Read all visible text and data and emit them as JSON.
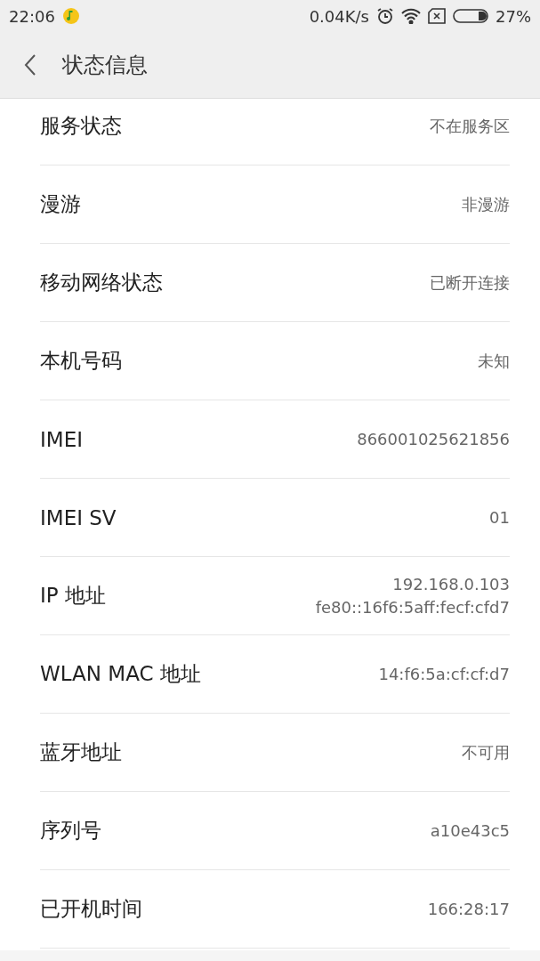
{
  "status_bar": {
    "time": "22:06",
    "speed": "0.04K/s",
    "battery": "27%"
  },
  "header": {
    "title": "状态信息"
  },
  "rows": [
    {
      "label": "服务状态",
      "values": [
        "不在服务区"
      ]
    },
    {
      "label": "漫游",
      "values": [
        "非漫游"
      ]
    },
    {
      "label": "移动网络状态",
      "values": [
        "已断开连接"
      ]
    },
    {
      "label": "本机号码",
      "values": [
        "未知"
      ]
    },
    {
      "label": "IMEI",
      "values": [
        "866001025621856"
      ]
    },
    {
      "label": "IMEI SV",
      "values": [
        "01"
      ]
    },
    {
      "label": "IP 地址",
      "values": [
        "192.168.0.103",
        "fe80::16f6:5aff:fecf:cfd7"
      ]
    },
    {
      "label": "WLAN MAC 地址",
      "values": [
        "14:f6:5a:cf:cf:d7"
      ]
    },
    {
      "label": "蓝牙地址",
      "values": [
        "不可用"
      ]
    },
    {
      "label": "序列号",
      "values": [
        "a10e43c5"
      ]
    },
    {
      "label": "已开机时间",
      "values": [
        "166:28:17"
      ]
    }
  ]
}
